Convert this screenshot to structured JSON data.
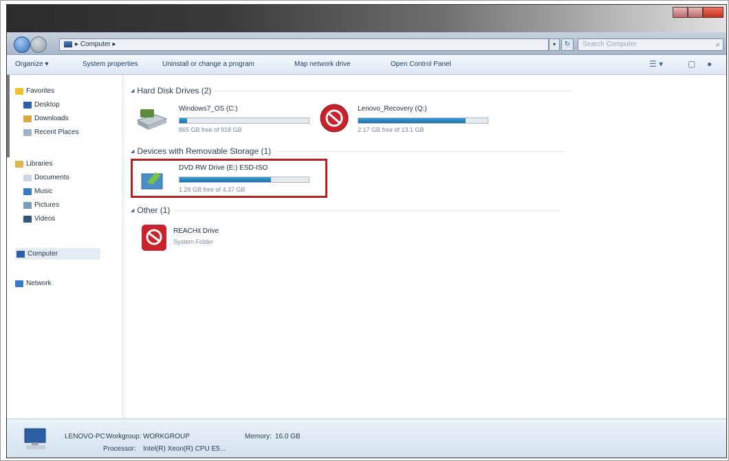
{
  "address": {
    "path": "Computer"
  },
  "search": {
    "placeholder": "Search Computer"
  },
  "toolbar": {
    "organize": "Organize ▾",
    "system_properties": "System properties",
    "uninstall": "Uninstall or change a program",
    "map_drive": "Map network drive",
    "control_panel": "Open Control Panel"
  },
  "nav": {
    "favorites": "Favorites",
    "desktop": "Desktop",
    "downloads": "Downloads",
    "recent": "Recent Places",
    "libraries": "Libraries",
    "documents": "Documents",
    "music": "Music",
    "pictures": "Pictures",
    "videos": "Videos",
    "computer": "Computer",
    "network": "Network"
  },
  "groups": {
    "hard_disk": "Hard Disk Drives (2)",
    "removable": "Devices with Removable Storage (1)",
    "other": "Other (1)"
  },
  "drives": {
    "c": {
      "name": "Windows7_OS (C:)",
      "free": "865 GB free of 918 GB",
      "used_fraction": 0.06
    },
    "q": {
      "name": "Lenovo_Recovery (Q:)",
      "free": "2.17 GB free of 13.1 GB",
      "used_fraction": 0.83
    },
    "e": {
      "name": "DVD RW Drive (E:) ESD-ISO",
      "free": "1.26 GB free of 4.37 GB",
      "used_fraction": 0.71
    },
    "reachit": {
      "name": "REACHit Drive",
      "sub": "System Folder"
    }
  },
  "details": {
    "pc_name": "LENOVO-PC",
    "workgroup_label": "Workgroup:",
    "workgroup": "WORKGROUP",
    "memory_label": "Memory:",
    "memory": "16.0 GB",
    "processor_label": "Processor:",
    "processor": "Intel(R) Xeon(R) CPU E5..."
  },
  "colors": {
    "highlight": "#b52025",
    "bar_fill": "#1b6ea8"
  }
}
